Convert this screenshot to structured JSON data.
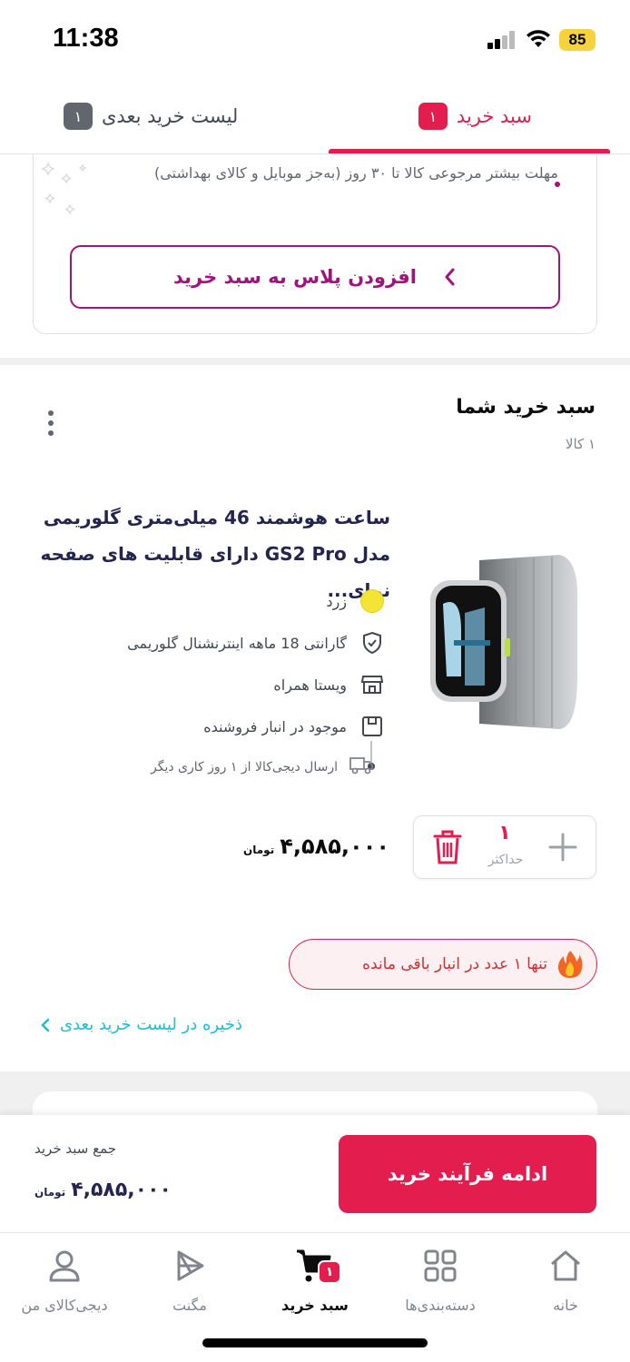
{
  "status_bar": {
    "time": "11:38",
    "battery": "85"
  },
  "tabs": {
    "cart": {
      "label": "سبد خرید",
      "count": "۱"
    },
    "next_list": {
      "label": "لیست خرید بعدی",
      "count": "۱"
    }
  },
  "plus": {
    "bullet_text": "مهلت بیشتر مرجوعی کالا تا ۳۰ روز (به‌جز موبایل و کالای بهداشتی)",
    "button_label": "افزودن پلاس به سبد خرید"
  },
  "cart": {
    "title": "سبد خرید شما",
    "item_count": "۱ کالا"
  },
  "product": {
    "name": "ساعت هوشمند 46 میلی‌متری گلوریمی مدل GS2 Pro دارای قابلیت های صفحه نمای...",
    "color": "زرد",
    "warranty": "گارانتی 18 ماهه اینترنشنال گلوریمی",
    "seller": "ویستا همراه",
    "stock_status": "موجود در انبار فروشنده",
    "shipping": "ارسال دیجی‌کالا از ۱ روز کاری دیگر",
    "quantity": "۱",
    "quantity_note": "حداکثر",
    "price": "۴,۵۸۵,۰۰۰",
    "currency": "تومان",
    "stock_warning": "تنها ۱ عدد در انبار باقی مانده",
    "save_for_later": "ذخیره در لیست خرید بعدی"
  },
  "checkout": {
    "button_label": "ادامه فرآیند خرید",
    "total_label": "جمع سبد خرید",
    "total": "۴,۵۸۵,۰۰۰",
    "currency": "تومان"
  },
  "bottom_nav": {
    "home": "خانه",
    "categories": "دسته‌بندی‌ها",
    "cart": "سبد خرید",
    "cart_badge": "۱",
    "magnet": "مگنت",
    "profile": "دیجی‌کالای من"
  },
  "colors": {
    "primary": "#e31e4f",
    "plus": "#a1137d",
    "link": "#19bfd3",
    "product_color": "#f4e534"
  }
}
